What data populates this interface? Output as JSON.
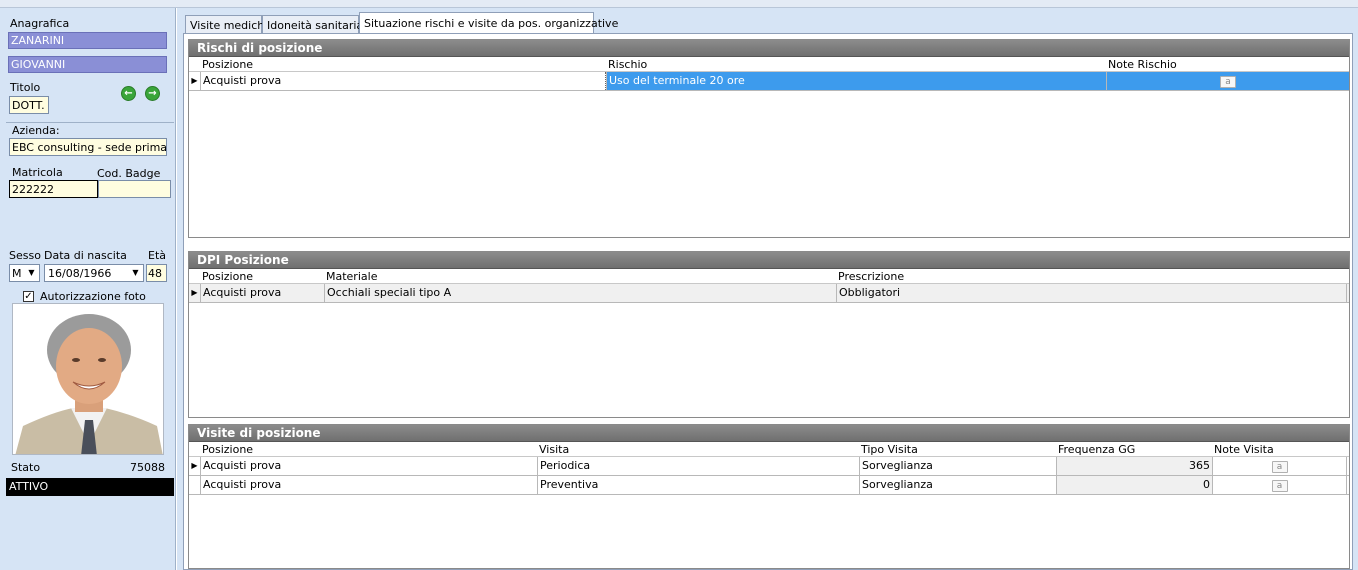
{
  "left": {
    "anagrafica_label": "Anagrafica",
    "cognome": "ZANARINI",
    "nome": "GIOVANNI",
    "titolo_label": "Titolo",
    "titolo_value": "DOTT.",
    "prev_icon": "arrow-left-icon",
    "next_icon": "arrow-right-icon",
    "azienda_label": "Azienda:",
    "azienda_value": "EBC consulting - sede primaria",
    "matricola_label": "Matricola",
    "matricola_value": "222222",
    "badge_label": "Cod. Badge",
    "badge_value": "",
    "sesso_label": "Sesso",
    "sesso_value": "M",
    "nascita_label": "Data di nascita",
    "nascita_value": "16/08/1966",
    "eta_label": "Età",
    "eta_value": "48",
    "autorizzazione_label": "Autorizzazione foto",
    "autorizzazione_checked": true,
    "stato_label": "Stato",
    "stato_code": "75088",
    "stato_value": "ATTIVO"
  },
  "tabs": [
    "Visite mediche",
    "Idoneità sanitaria",
    "Situazione rischi e visite da pos. organizzative"
  ],
  "active_tab": 2,
  "rischi": {
    "title": "Rischi di posizione",
    "columns": [
      "Posizione",
      "Rischio",
      "Note Rischio"
    ],
    "rows": [
      {
        "posizione": "Acquisti prova",
        "rischio": "Uso del terminale 20 ore",
        "note_icon": "note-icon"
      }
    ]
  },
  "dpi": {
    "title": "DPI Posizione",
    "columns": [
      "Posizione",
      "Materiale",
      "Prescrizione"
    ],
    "rows": [
      {
        "posizione": "Acquisti prova",
        "materiale": "Occhiali speciali tipo A",
        "prescrizione": "Obbligatori"
      }
    ]
  },
  "visite": {
    "title": "Visite di posizione",
    "columns": [
      "Posizione",
      "Visita",
      "Tipo Visita",
      "Frequenza GG",
      "Note Visita"
    ],
    "rows": [
      {
        "posizione": "Acquisti prova",
        "visita": "Periodica",
        "tipo": "Sorveglianza",
        "frequenza": "365",
        "note_icon": "note-icon"
      },
      {
        "posizione": "Acquisti prova",
        "visita": "Preventiva",
        "tipo": "Sorveglianza",
        "frequenza": "0",
        "note_icon": "note-icon"
      }
    ]
  },
  "colors": {
    "panel_bg": "#d6e4f5",
    "name_fill": "#8a8fd6",
    "selection": "#3d9bed",
    "section_header": "#7a7a7a"
  }
}
